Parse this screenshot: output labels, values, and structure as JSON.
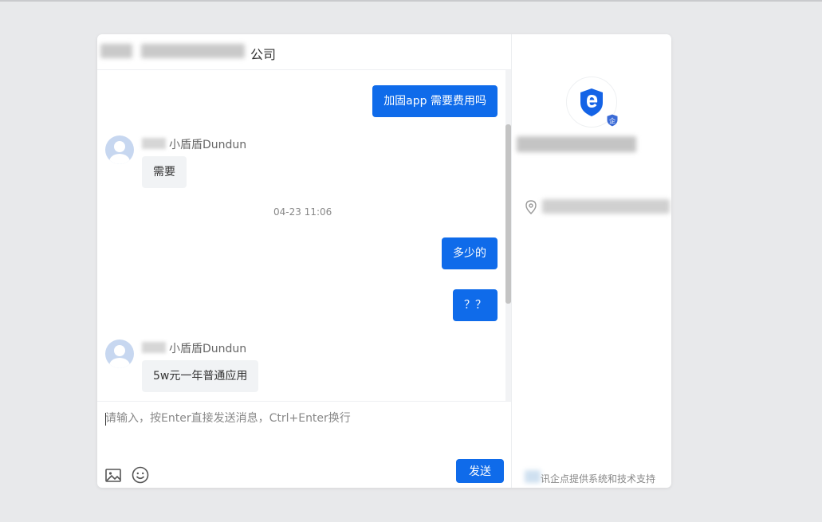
{
  "chat": {
    "title_suffix": "公司",
    "messages": {
      "m1": "加固app 需要费用吗",
      "m2_sender": "小盾盾Dundun",
      "m2": "需要",
      "time1": "04-23 11:06",
      "m3": "多少的",
      "m4": "？？",
      "m5_sender": "小盾盾Dundun",
      "m5": "5w元一年普通应用"
    }
  },
  "composer": {
    "placeholder": "请输入，按Enter直接发送消息，Ctrl+Enter换行",
    "image_icon": "image-icon",
    "emoji_icon": "emoji-icon",
    "send_label": "发送"
  },
  "side": {
    "logo_icon": "shield-e-logo-icon",
    "badge_text": "企",
    "location_icon": "location-pin-icon",
    "footer": "讯企点提供系统和技术支持"
  },
  "colors": {
    "accent": "#0f6bea",
    "background": "#e8e9eb"
  }
}
